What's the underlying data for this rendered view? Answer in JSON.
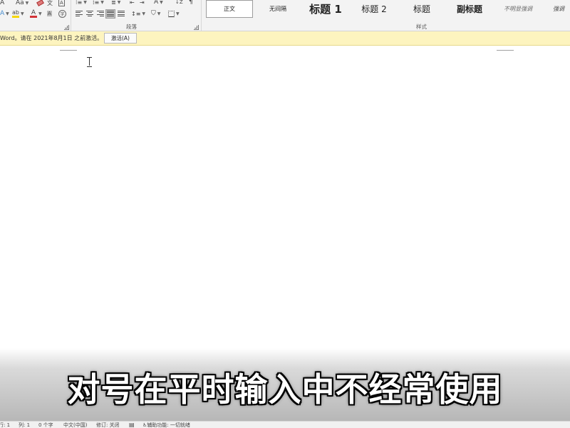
{
  "ribbon": {
    "font_group": {
      "row1": {
        "grow_font": "A",
        "change_case": "Aa",
        "clear_format_icon": "eraser-icon",
        "phonetic_guide_icon": "phonetic-guide-icon",
        "enclose_char": "A"
      },
      "row2": {
        "text_effect": "A",
        "highlight": "ab",
        "font_color": "A",
        "char_shading": "A",
        "enclose_char": "字"
      },
      "accent_red": "#d13438",
      "accent_yellow": "#f5d600"
    },
    "paragraph_group": {
      "label": "段落",
      "sort_icon": "sort-icon",
      "show_marks_icon": "pilcrow-icon",
      "char_style": "A",
      "line_spacing_icon": "line-spacing-icon",
      "shading_icon": "paint-bucket-icon",
      "border_icon": "border-icon",
      "active_alignment": "justify"
    },
    "styles_group": {
      "label": "样式",
      "items": [
        {
          "label": "正文",
          "selected": true
        },
        {
          "label": "无间隔"
        },
        {
          "label": "标题 1"
        },
        {
          "label": "标题 2"
        },
        {
          "label": "标题"
        },
        {
          "label": "副标题"
        },
        {
          "label": "不明显强调"
        },
        {
          "label": "强调"
        }
      ]
    }
  },
  "notification": {
    "message": "Word。请在 2021年8月1日 之前激活。",
    "activate_label": "激活(A)",
    "background": "#fdf4bf"
  },
  "document": {
    "caption": "对号在平时输入中不经常使用"
  },
  "status_bar": {
    "items": [
      "行: 1",
      "列: 1",
      "0 个字",
      "中文(中国)",
      "修订: 关闭",
      "辅助功能: 一切就绪"
    ]
  }
}
